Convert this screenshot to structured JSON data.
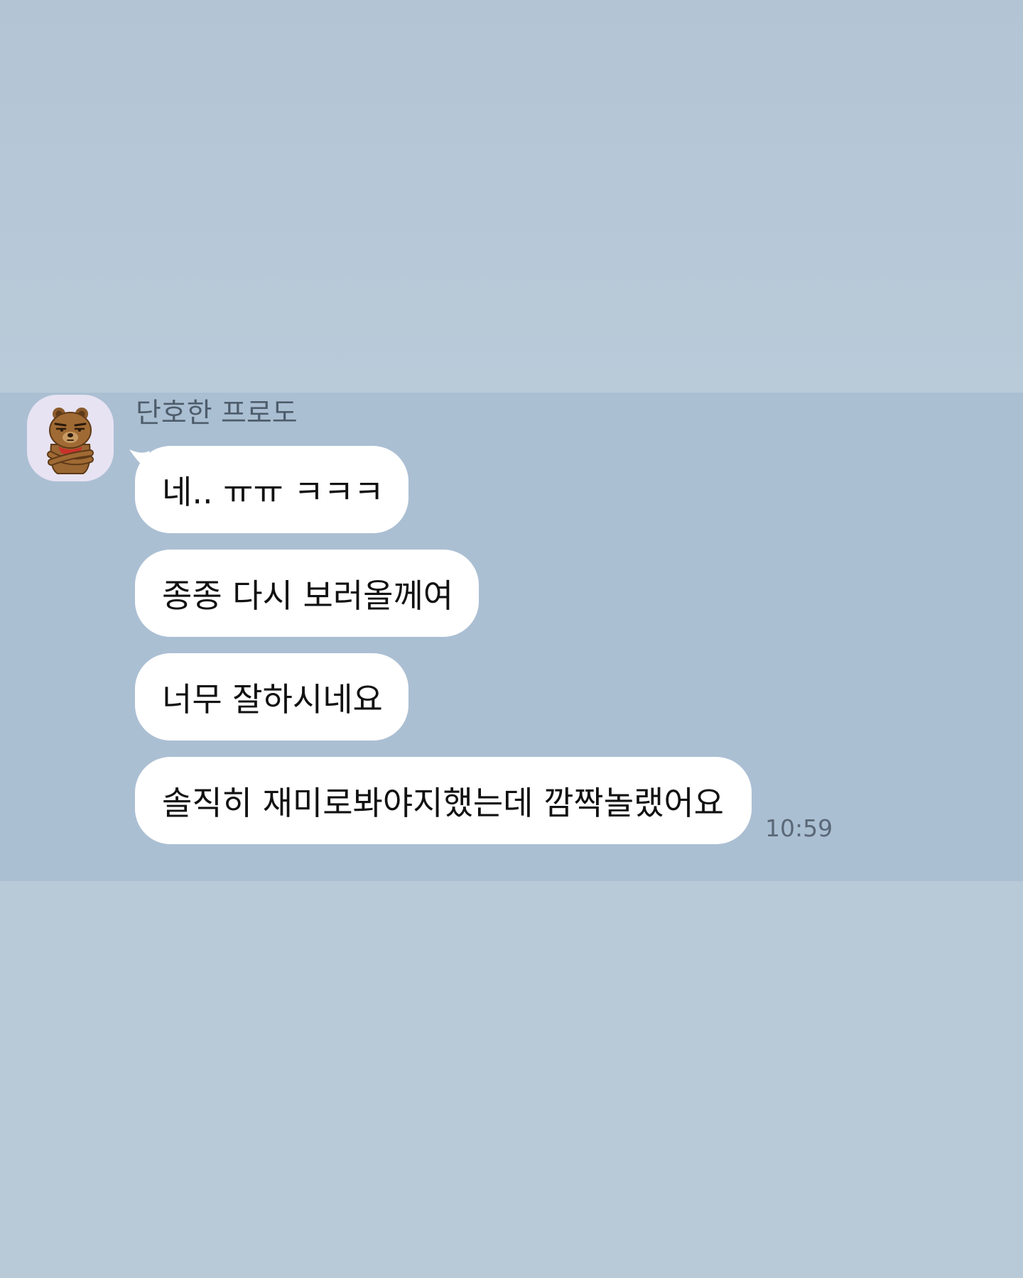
{
  "chat": {
    "sender": {
      "name": "단호한 프로도",
      "avatar_icon": "bear-character-avatar-icon"
    },
    "messages": [
      {
        "text": "네.. ㅠㅠ ㅋㅋㅋ"
      },
      {
        "text": "종종 다시 보러올께여"
      },
      {
        "text": "너무 잘하시네요"
      },
      {
        "text": "솔직히 재미로봐야지했는데 깜짝놀랬어요"
      }
    ],
    "timestamp": "10:59"
  },
  "colors": {
    "background": "#b8cad8",
    "highlight_band": "#abbfd3",
    "bubble": "#ffffff",
    "avatar_background": "#e7e3f2",
    "sender_name": "#4e5d6b",
    "timestamp": "#5a6877"
  }
}
